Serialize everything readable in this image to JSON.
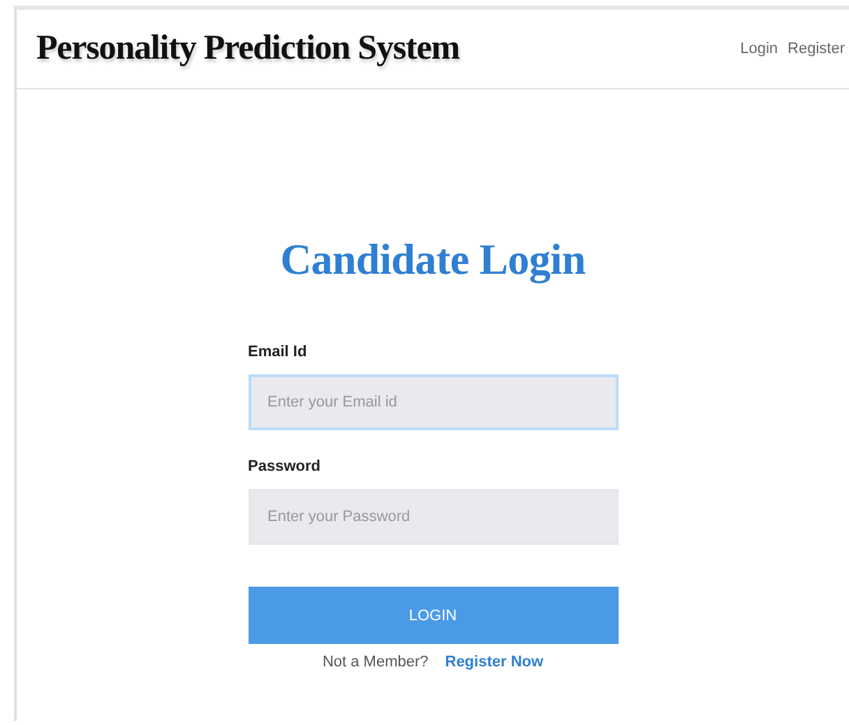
{
  "header": {
    "title": "Personality Prediction System",
    "nav": [
      {
        "label": "Login"
      },
      {
        "label": "Register"
      }
    ]
  },
  "heading": "Candidate Login",
  "fields": [
    {
      "label": "Email Id",
      "placeholder": "Enter your Email id",
      "focused": true
    },
    {
      "label": "Password",
      "placeholder": "Enter your Password",
      "focused": false
    }
  ],
  "button": "LOGIN",
  "footer": {
    "text": "Not a Member?",
    "link": "Register Now"
  }
}
